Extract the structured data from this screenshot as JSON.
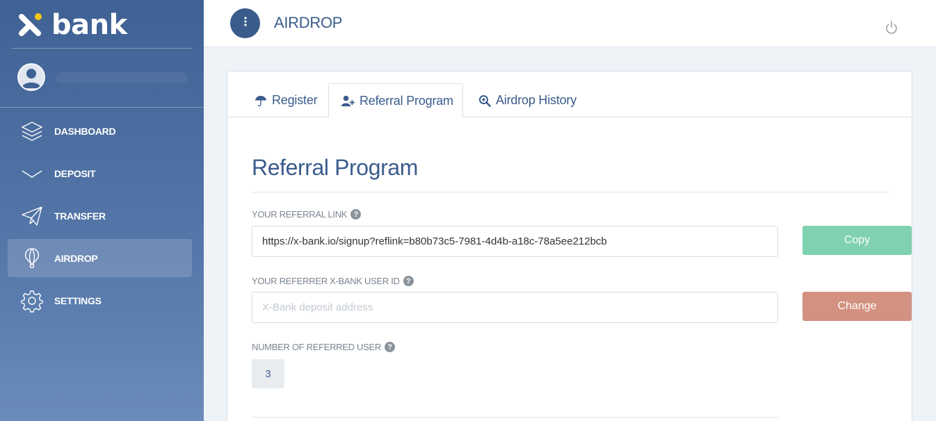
{
  "brand": {
    "name": "bank"
  },
  "sidebar": {
    "items": [
      {
        "label": "DASHBOARD",
        "icon": "layers-icon"
      },
      {
        "label": "DEPOSIT",
        "icon": "chevron-down-icon"
      },
      {
        "label": "TRANSFER",
        "icon": "paper-plane-icon"
      },
      {
        "label": "AIRDROP",
        "icon": "balloon-icon",
        "active": true
      },
      {
        "label": "SETTINGS",
        "icon": "gear-icon"
      }
    ]
  },
  "header": {
    "title": "AIRDROP"
  },
  "tabs": [
    {
      "label": "Register",
      "icon": "umbrella-icon"
    },
    {
      "label": "Referral Program",
      "icon": "user-plus-icon",
      "active": true
    },
    {
      "label": "Airdrop History",
      "icon": "search-plus-icon"
    }
  ],
  "referral": {
    "title": "Referral Program",
    "link_label": "YOUR REFERRAL LINK",
    "link_value": "https://x-bank.io/signup?reflink=b80b73c5-7981-4d4b-a18c-78a5ee212bcb",
    "copy_label": "Copy",
    "referrer_label": "YOUR REFERRER X-BANK USER ID",
    "referrer_placeholder": "X-Bank deposit address",
    "change_label": "Change",
    "count_label": "NUMBER OF REFERRED USER",
    "count_value": "3"
  },
  "colors": {
    "primary": "#3a5c8c",
    "copy": "#7fd1b0",
    "change": "#d39181",
    "logo_accent": "#f5c518"
  }
}
